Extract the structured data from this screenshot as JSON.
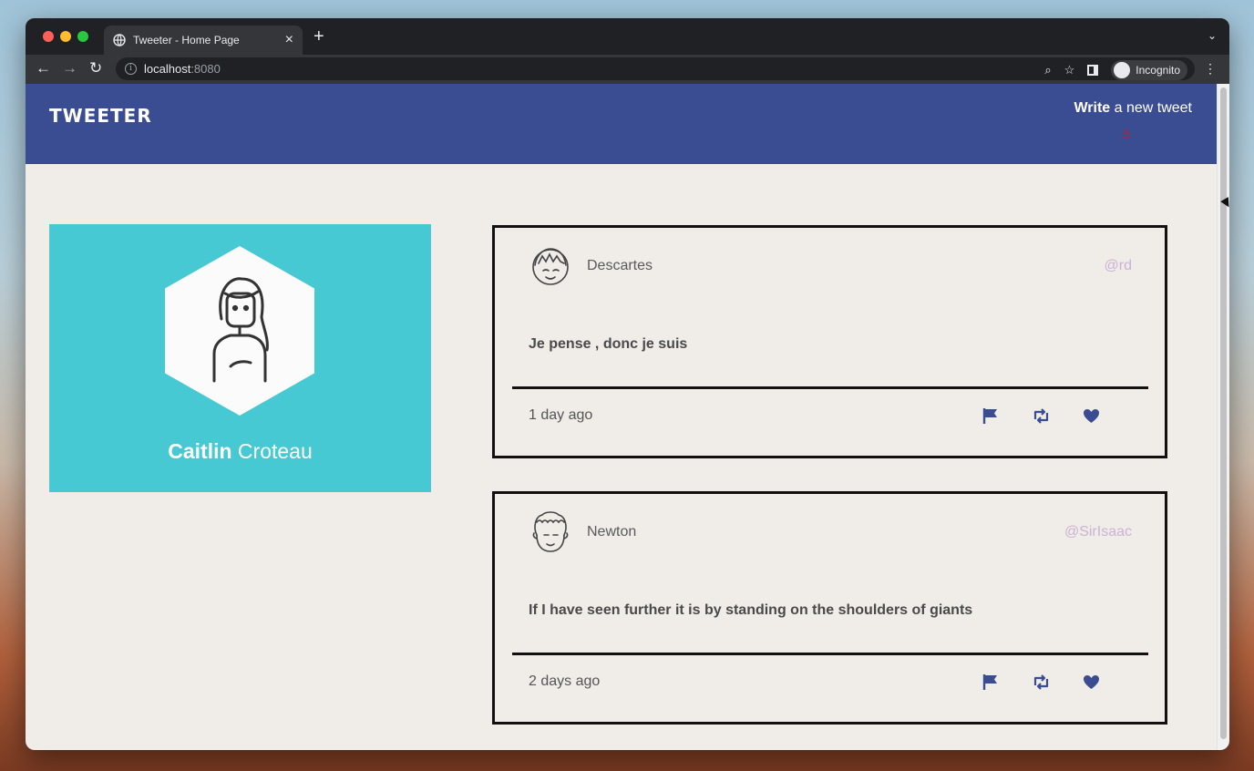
{
  "browser": {
    "tab_title": "Tweeter - Home Page",
    "tab_close": "×",
    "new_tab": "+",
    "tabs_menu": "⌄",
    "url_host": "localhost",
    "url_port": ":8080",
    "incognito_label": "Incognito",
    "back": "←",
    "forward": "→",
    "reload": "↻",
    "zoom_icon": "⌕",
    "star_icon": "☆",
    "kebab": "⋮"
  },
  "header": {
    "brand": "TWEETER",
    "compose_bold": "Write",
    "compose_rest": " a new tweet",
    "compose_icon": "chevron-double-down-icon",
    "compose_glyph": "≚"
  },
  "profile": {
    "first_name": "Caitlin",
    "last_name": " Croteau"
  },
  "tweets": [
    {
      "name": "Descartes",
      "handle": "@rd",
      "content": "Je pense , donc je suis",
      "time": "1 day ago"
    },
    {
      "name": "Newton",
      "handle": "@SirIsaac",
      "content": "If I have seen further it is by standing on the shoulders of giants",
      "time": "2 days ago"
    }
  ],
  "colors": {
    "header_bg": "#3a4c92",
    "page_bg": "#f0ece8",
    "profile_bg": "#46c9d3",
    "action_icons": "#3a4c92",
    "handle": "#cbb3d6"
  }
}
